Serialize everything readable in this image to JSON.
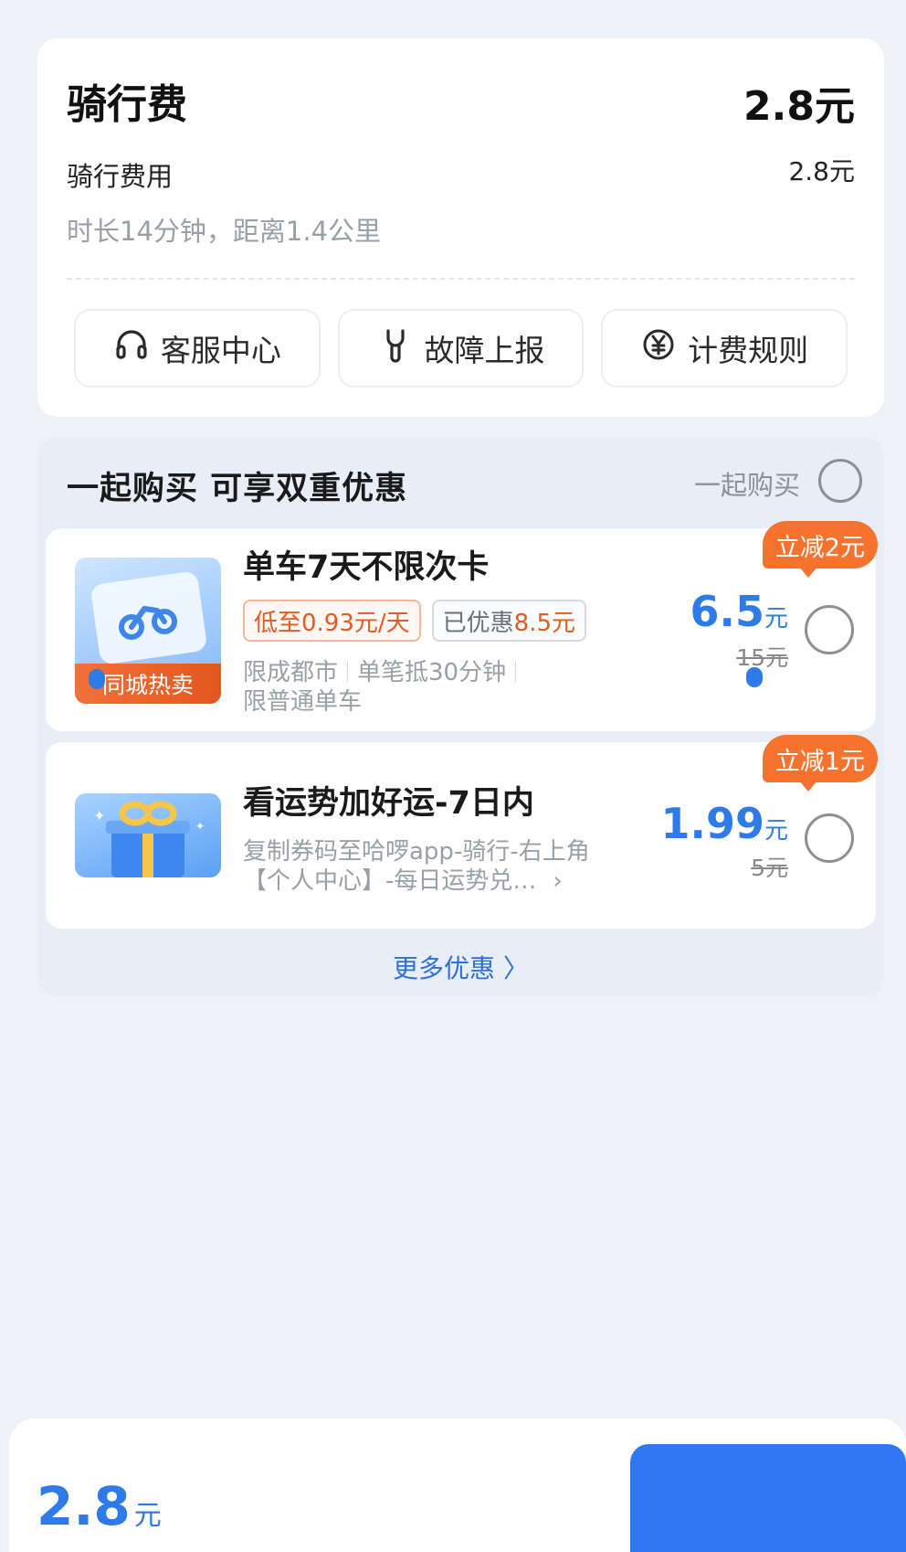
{
  "fee": {
    "title": "骑行费",
    "total": "2.8元",
    "item_label": "骑行费用",
    "item_value": "2.8元",
    "detail": "时长14分钟，距离1.4公里"
  },
  "actions": [
    {
      "label": "客服中心",
      "icon": "headset-icon"
    },
    {
      "label": "故障上报",
      "icon": "wrench-icon"
    },
    {
      "label": "计费规则",
      "icon": "yen-coin-icon"
    }
  ],
  "bundle": {
    "title": "一起购买  可享双重优惠",
    "toggle_label": "一起购买",
    "more_label": "更多优惠 〉"
  },
  "offers": [
    {
      "name": "单车7天不限次卡",
      "badge": "同城热卖",
      "tag1": "低至0.93元/天",
      "tag2_prefix": "已优惠",
      "tag2_value": "8.5元",
      "desc_1": "限成都市",
      "desc_2": "单笔抵30分钟",
      "desc_3": "限普通单车",
      "price": "6.5",
      "unit": "元",
      "original": "15元",
      "discount": "立减2元"
    },
    {
      "name": "看运势加好运-7日内",
      "desc": "复制券码至哈啰app-骑行-右上角【个人中心】-每日运势兑…",
      "price": "1.99",
      "unit": "元",
      "original": "5元",
      "discount": "立减1元"
    }
  ],
  "bottom": {
    "total_num": "2.8",
    "total_unit": "元"
  },
  "colors": {
    "accent": "#2e7ae6",
    "orange": "#f5732e",
    "background": "#eef1f7"
  }
}
